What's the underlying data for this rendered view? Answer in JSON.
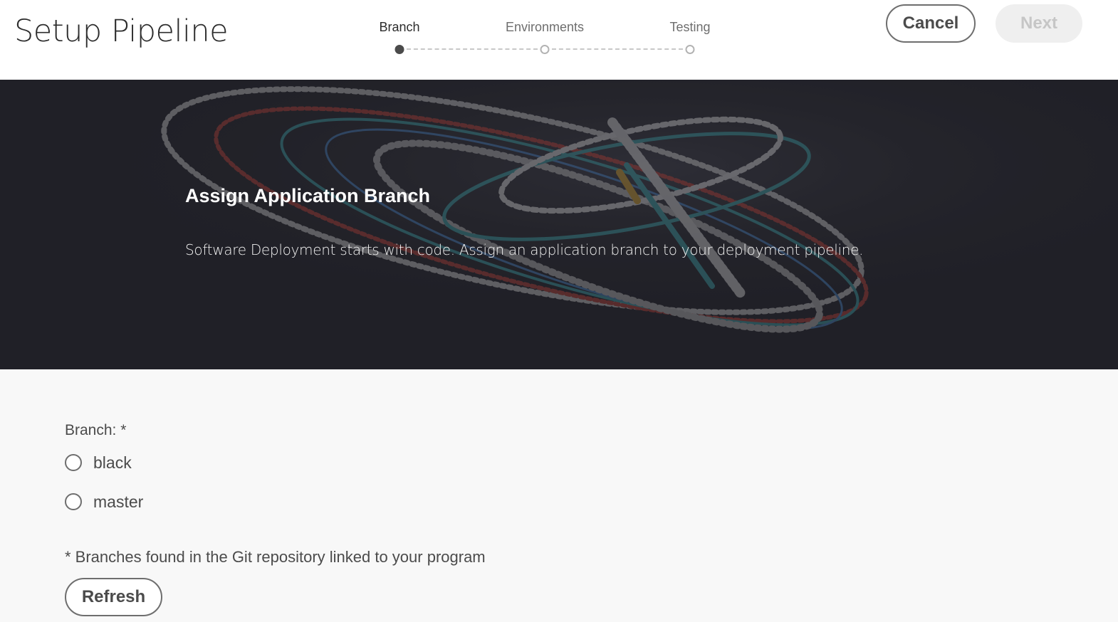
{
  "header": {
    "title": "Setup Pipeline",
    "cancel_label": "Cancel",
    "next_label": "Next"
  },
  "stepper": {
    "steps": [
      {
        "label": "Branch",
        "state": "active"
      },
      {
        "label": "Environments",
        "state": "pending"
      },
      {
        "label": "Testing",
        "state": "pending"
      }
    ]
  },
  "hero": {
    "title": "Assign Application Branch",
    "description": "Software Deployment starts with code. Assign an application branch to your deployment pipeline."
  },
  "form": {
    "branch_label": "Branch: *",
    "options": [
      {
        "label": "black",
        "selected": false
      },
      {
        "label": "master",
        "selected": false
      }
    ],
    "help_text": "* Branches found in the Git repository linked to your program",
    "refresh_label": "Refresh"
  },
  "colors": {
    "hero_background": "#23232a",
    "primary_text": "#4b4b4b",
    "disabled_button_bg": "#efefef",
    "disabled_button_text": "#c6c6c6"
  }
}
